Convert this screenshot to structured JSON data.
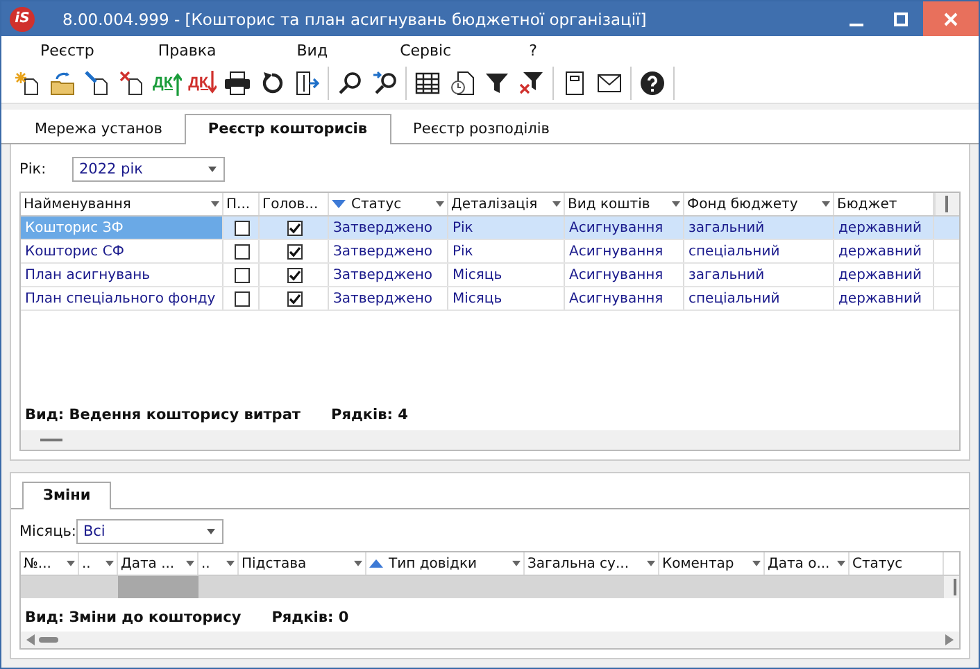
{
  "window": {
    "logo": "iS",
    "title": "8.00.004.999 - [Кошторис та план асигнувань бюджетної організації]"
  },
  "menu": [
    "Реєстр",
    "Правка",
    "Вид",
    "Сервіс",
    "?"
  ],
  "toolbar": [
    [
      {
        "kind": "new"
      },
      {
        "kind": "open"
      },
      {
        "kind": "edit"
      },
      {
        "kind": "delete"
      },
      {
        "kind": "dk-up",
        "label": "ДК"
      },
      {
        "kind": "dk-down",
        "label": "ДК"
      },
      {
        "kind": "print"
      },
      {
        "kind": "refresh"
      },
      {
        "kind": "exit"
      }
    ],
    [
      {
        "kind": "search"
      },
      {
        "kind": "search-next"
      }
    ],
    [
      {
        "kind": "grid"
      },
      {
        "kind": "history"
      },
      {
        "kind": "filter"
      },
      {
        "kind": "filter-clear"
      }
    ],
    [
      {
        "kind": "note"
      },
      {
        "kind": "mail"
      }
    ],
    [
      {
        "kind": "help"
      }
    ]
  ],
  "tabs": [
    {
      "label": "Мережа установ",
      "selected": false
    },
    {
      "label": "Реєстр кошторисів",
      "selected": true
    },
    {
      "label": "Реєстр розподілів",
      "selected": false
    }
  ],
  "year": {
    "label": "Рік:",
    "value": "2022 рік"
  },
  "table": {
    "columns": [
      {
        "label": "Найменування",
        "filter": true
      },
      {
        "label": "П...",
        "filter": false
      },
      {
        "label": "Голов...",
        "filter": false
      },
      {
        "label": "Статус",
        "filter": true,
        "sort_ascending": false
      },
      {
        "label": "Деталізація",
        "filter": true
      },
      {
        "label": "Вид коштів",
        "filter": true
      },
      {
        "label": "Фонд бюджету",
        "filter": true
      },
      {
        "label": "Бюджет",
        "filter": false
      }
    ],
    "rows": [
      {
        "selected": true,
        "name": "Кошторис ЗФ",
        "p": false,
        "main": true,
        "status": "Затверджено",
        "detail": "Рік",
        "funds": "Асигнування",
        "fund": "загальний",
        "budget": "державний"
      },
      {
        "selected": false,
        "name": "Кошторис СФ",
        "p": false,
        "main": true,
        "status": "Затверджено",
        "detail": "Рік",
        "funds": "Асигнування",
        "fund": "спеціальний",
        "budget": "державний"
      },
      {
        "selected": false,
        "name": "План асигнувань",
        "p": false,
        "main": true,
        "status": "Затверджено",
        "detail": "Місяць",
        "funds": "Асигнування",
        "fund": "загальний",
        "budget": "державний"
      },
      {
        "selected": false,
        "name": "План спеціального фонду",
        "p": false,
        "main": true,
        "status": "Затверджено",
        "detail": "Місяць",
        "funds": "Асигнування",
        "fund": "спеціальний",
        "budget": "державний"
      }
    ],
    "footer_view": "Вид: Ведення кошторису витрат",
    "footer_rows": "Рядків: 4"
  },
  "bottom": {
    "tab": {
      "label": "Зміни",
      "selected": true
    },
    "month": {
      "label": "Місяць:",
      "value": "Всі"
    },
    "columns": [
      {
        "label": "№...",
        "filter": true
      },
      {
        "label": "..",
        "filter": true
      },
      {
        "label": "Дата ...",
        "filter": true,
        "focused": true
      },
      {
        "label": "..",
        "filter": true
      },
      {
        "label": "Підстава",
        "filter": true
      },
      {
        "label": "Тип довідки",
        "filter": true,
        "sort_ascending": true
      },
      {
        "label": "Загальна су...",
        "filter": true
      },
      {
        "label": "Коментар",
        "filter": true
      },
      {
        "label": "Дата о...",
        "filter": true
      },
      {
        "label": "Статус",
        "filter": false
      }
    ],
    "footer_view": "Вид: Зміни до кошторису",
    "footer_rows": "Рядків: 0"
  }
}
